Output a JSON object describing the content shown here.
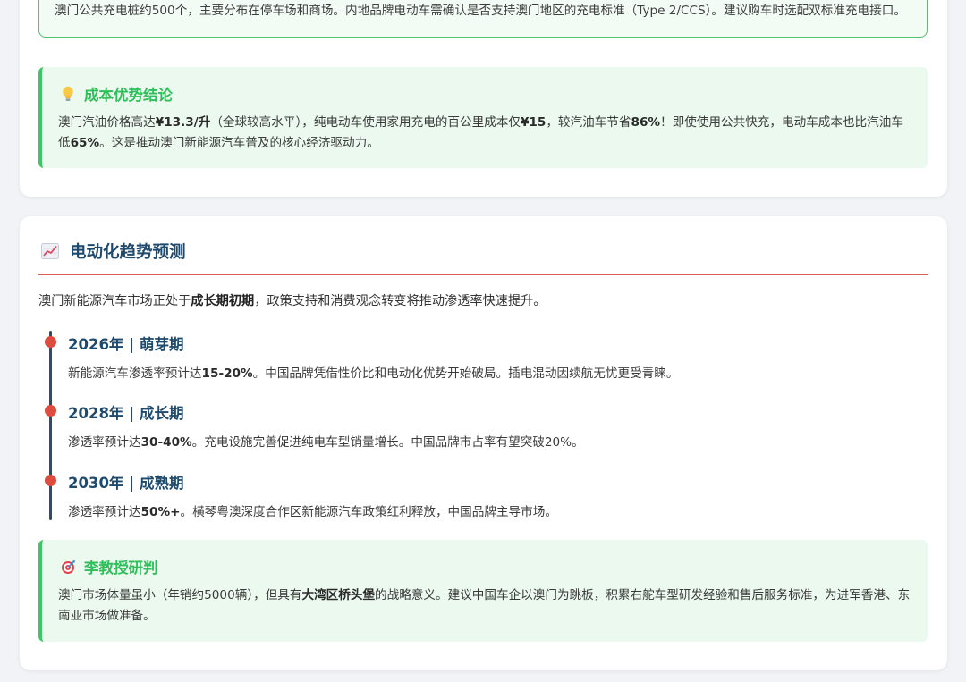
{
  "charging_note": {
    "text": "澳门公共充电桩约500个，主要分布在停车场和商场。内地品牌电动车需确认是否支持澳门地区的充电标准（Type 2/CCS）。建议购车时选配双标准充电接口。"
  },
  "cost_conclusion": {
    "icon": "lightbulb-icon",
    "title": "成本优势结论",
    "text_parts": [
      {
        "t": "澳门汽油价格高达",
        "b": false
      },
      {
        "t": "¥13.3/升",
        "b": true
      },
      {
        "t": "（全球较高水平），纯电动车使用家用充电的百公里成本仅",
        "b": false
      },
      {
        "t": "¥15",
        "b": true
      },
      {
        "t": "，较汽油车节省",
        "b": false
      },
      {
        "t": "86%",
        "b": true
      },
      {
        "t": "！即使使用公共快充，电动车成本也比汽油车低",
        "b": false
      },
      {
        "t": "65%",
        "b": true
      },
      {
        "t": "。这是推动澳门新能源汽车普及的核心经济驱动力。",
        "b": false
      }
    ]
  },
  "trend_section": {
    "icon": "chart-increasing-icon",
    "title": "电动化趋势预测",
    "intro_parts": [
      {
        "t": "澳门新能源汽车市场正处于",
        "b": false
      },
      {
        "t": "成长期初期",
        "b": true
      },
      {
        "t": "，政策支持和消费观念转变将推动渗透率快速提升。",
        "b": false
      }
    ],
    "timeline": [
      {
        "title": "2026年 | 萌芽期",
        "text_parts": [
          {
            "t": "新能源汽车渗透率预计达",
            "b": false
          },
          {
            "t": "15-20%",
            "b": true
          },
          {
            "t": "。中国品牌凭借性价比和电动化优势开始破局。插电混动因续航无忧更受青睐。",
            "b": false
          }
        ]
      },
      {
        "title": "2028年 | 成长期",
        "text_parts": [
          {
            "t": "渗透率预计达",
            "b": false
          },
          {
            "t": "30-40%",
            "b": true
          },
          {
            "t": "。充电设施完善促进纯电车型销量增长。中国品牌市占率有望突破20%。",
            "b": false
          }
        ]
      },
      {
        "title": "2030年 | 成熟期",
        "text_parts": [
          {
            "t": "渗透率预计达",
            "b": false
          },
          {
            "t": "50%+",
            "b": true
          },
          {
            "t": "。横琴粤澳深度合作区新能源汽车政策红利释放，中国品牌主导市场。",
            "b": false
          }
        ]
      }
    ],
    "professor": {
      "icon": "target-icon",
      "title": "李教授研判",
      "text_parts": [
        {
          "t": "澳门市场体量虽小（年销约5000辆），但具有",
          "b": false
        },
        {
          "t": "大湾区桥头堡",
          "b": true
        },
        {
          "t": "的战略意义。建议中国车企以澳门为跳板，积累右舵车型研发经验和售后服务标准，为进军香港、东南亚市场做准备。",
          "b": false
        }
      ]
    }
  },
  "colors": {
    "accent_green": "#2ebf5a",
    "heading_navy": "#1e4a6e",
    "rule_red": "#d9604f",
    "dot_red": "#de4b3f"
  }
}
